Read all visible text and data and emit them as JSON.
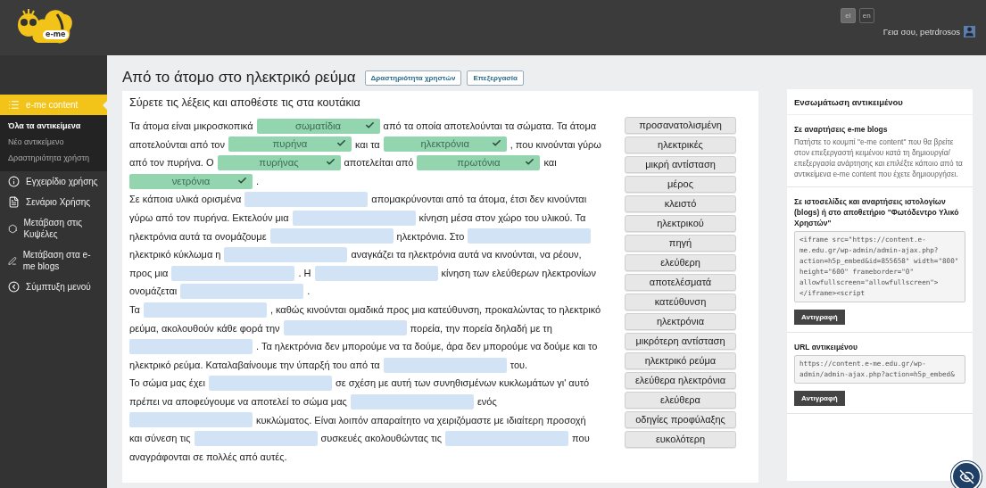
{
  "header": {
    "logo_text": "e-me",
    "languages": [
      {
        "label": "el",
        "selected": true
      },
      {
        "label": "en",
        "selected": false
      }
    ],
    "greeting": "Γεια σου, petrdrosos"
  },
  "sidebar": {
    "items": [
      {
        "label": "e-me content",
        "selected": true,
        "expanded": true,
        "children": [
          {
            "label": "Όλα τα αντικείμενα",
            "selected": true
          },
          {
            "label": "Νέο αντικείμενο",
            "selected": false
          },
          {
            "label": "Δραστηριότητα χρήστη",
            "selected": false
          }
        ]
      },
      {
        "label": "Εγχειρίδιο χρήσης",
        "selected": false
      },
      {
        "label": "Σενάριο Χρήσης",
        "selected": false
      },
      {
        "label": "Μετάβαση στις Κυψέλες",
        "selected": false
      },
      {
        "label": "Μετάβαση στα e-me blogs",
        "selected": false
      },
      {
        "label": "Σύμπτυξη μενού",
        "selected": false
      }
    ]
  },
  "page": {
    "title": "Από το άτομο στο ηλεκτρικό ρεύμα",
    "buttons": [
      "Δραστηριότητα χρηστών",
      "Επεξεργασία"
    ],
    "instruction": "Σύρετε τις λέξεις και αποθέστε τις στα κουτάκια",
    "paragraphs": [
      [
        {
          "kind": "text",
          "text": "Τα άτομα είναι μικροσκοπικά"
        },
        {
          "kind": "answer",
          "text": "σωματίδια",
          "correct": true
        },
        {
          "kind": "text",
          "text": "από τα οποία αποτελούνται τα σώματα. Τα άτομα"
        }
      ],
      [
        {
          "kind": "text",
          "text": "αποτελούνται από τον"
        },
        {
          "kind": "answer",
          "text": "πυρήνα",
          "correct": true
        },
        {
          "kind": "text",
          "text": "και τα"
        },
        {
          "kind": "answer",
          "text": "ηλεκτρόνια",
          "correct": true
        },
        {
          "kind": "text",
          "text": ", που κινούνται γύρω"
        }
      ],
      [
        {
          "kind": "text",
          "text": "από τον πυρήνα. Ο"
        },
        {
          "kind": "answer",
          "text": "πυρήνας",
          "correct": true
        },
        {
          "kind": "text",
          "text": "αποτελείται από"
        },
        {
          "kind": "answer",
          "text": "πρωτόνια",
          "correct": true
        },
        {
          "kind": "text",
          "text": "και"
        }
      ],
      [
        {
          "kind": "answer",
          "text": "νετρόνια",
          "correct": true
        },
        {
          "kind": "text",
          "text": "."
        }
      ],
      [
        {
          "kind": "text",
          "text": "Σε κάποια υλικά ορισμένα"
        },
        {
          "kind": "blank"
        },
        {
          "kind": "text",
          "text": "απομακρύνονται από τα άτομα, έτσι δεν κινούνται"
        }
      ],
      [
        {
          "kind": "text",
          "text": "γύρω από τον πυρήνα. Εκτελούν μια"
        },
        {
          "kind": "blank"
        },
        {
          "kind": "text",
          "text": "κίνηση μέσα στον χώρο του υλικού. Τα"
        }
      ],
      [
        {
          "kind": "text",
          "text": "ηλεκτρόνια αυτά τα ονομάζουμε"
        },
        {
          "kind": "blank"
        },
        {
          "kind": "text",
          "text": "ηλεκτρόνια. Στο"
        },
        {
          "kind": "blank"
        }
      ],
      [
        {
          "kind": "text",
          "text": "ηλεκτρικό κύκλωμα η"
        },
        {
          "kind": "blank"
        },
        {
          "kind": "text",
          "text": "αναγκάζει τα ηλεκτρόνια αυτά να κινούνται, να ρέουν,"
        }
      ],
      [
        {
          "kind": "text",
          "text": "προς μια"
        },
        {
          "kind": "blank"
        },
        {
          "kind": "text",
          "text": ". Η"
        },
        {
          "kind": "blank"
        },
        {
          "kind": "text",
          "text": "κίνηση των ελεύθερων ηλεκτρονίων"
        }
      ],
      [
        {
          "kind": "text",
          "text": "ονομάζεται"
        },
        {
          "kind": "blank"
        },
        {
          "kind": "text",
          "text": "."
        }
      ],
      [
        {
          "kind": "text",
          "text": "Τα"
        },
        {
          "kind": "blank"
        },
        {
          "kind": "text",
          "text": ", καθώς κινούνται ομαδικά προς μια κατεύθυνση, προκαλώντας το ηλεκτρικό"
        }
      ],
      [
        {
          "kind": "text",
          "text": "ρεύμα, ακολουθούν κάθε φορά την"
        },
        {
          "kind": "blank"
        },
        {
          "kind": "text",
          "text": "πορεία, την πορεία δηλαδή με τη"
        }
      ],
      [
        {
          "kind": "blank"
        },
        {
          "kind": "text",
          "text": ". Τα ηλεκτρόνια δεν μπορούμε να τα δούμε, άρα δεν μπορούμε να δούμε και το"
        }
      ],
      [
        {
          "kind": "text",
          "text": "ηλεκτρικό ρεύμα. Καταλαβαίνουμε την ύπαρξή του από τα"
        },
        {
          "kind": "blank"
        },
        {
          "kind": "text",
          "text": "του."
        }
      ],
      [
        {
          "kind": "text",
          "text": "Το σώμα μας έχει"
        },
        {
          "kind": "blank"
        },
        {
          "kind": "text",
          "text": "σε σχέση με αυτή των συνηθισμένων κυκλωμάτων γι' αυτό"
        }
      ],
      [
        {
          "kind": "text",
          "text": "πρέπει να αποφεύγουμε να αποτελεί το σώμα μας"
        },
        {
          "kind": "blank"
        },
        {
          "kind": "text",
          "text": "ενός"
        }
      ],
      [
        {
          "kind": "blank"
        },
        {
          "kind": "text",
          "text": "κυκλώματος. Είναι λοιπόν απαραίτητο να χειριζόμαστε με ιδιαίτερη προσοχή"
        }
      ],
      [
        {
          "kind": "text",
          "text": "και σύνεση τις"
        },
        {
          "kind": "blank"
        },
        {
          "kind": "text",
          "text": "συσκευές ακολουθώντας τις"
        },
        {
          "kind": "blank"
        },
        {
          "kind": "text",
          "text": "που"
        }
      ],
      [
        {
          "kind": "text",
          "text": "αναγράφονται σε πολλές από αυτές."
        }
      ]
    ],
    "word_bank": [
      "προσανατολισμένη",
      "ηλεκτρικές",
      "μικρή αντίσταση",
      "μέρος",
      "κλειστό",
      "ηλεκτρικού",
      "πηγή",
      "ελεύθερη",
      "αποτελέσματά",
      "κατεύθυνση",
      "ηλεκτρόνια",
      "μικρότερη αντίσταση",
      "ηλεκτρικό ρεύμα",
      "ελεύθερα ηλεκτρόνια",
      "ελεύθερα",
      "οδηγίες προφύλαξης",
      "ευκολότερη"
    ]
  },
  "embed_panel": {
    "title": "Ενσωμάτωση αντικειμένου",
    "sections": [
      {
        "kind": "info",
        "heading": "Σε αναρτήσεις e-me blogs",
        "text": "Πατήστε το κουμπί \"e-me content\" που θα βρείτε στον επεξεργαστή κειμένου κατά τη δημιουργία/επεξεργασία ανάρτησης και επιλέξτε κάποιο από τα αντικείμενα e-me content που έχετε δημιουργήσει."
      },
      {
        "kind": "code",
        "heading": "Σε ιστοσελίδες και αναρτήσεις ιστολογίων (blogs) ή στο αποθετήριο \"Φωτόδεντρο Υλικό Χρηστών\"",
        "code": "<iframe src=\"https://content.e-me.edu.gr/wp-admin/admin-ajax.php?action=h5p_embed&id=855658\" width=\"800\" height=\"600\" frameborder=\"0\" allowfullscreen=\"allowfullscreen\"></iframe><script",
        "button": "Αντιγραφή"
      },
      {
        "kind": "code",
        "heading": "URL αντικειμένου",
        "code": "https://content.e-me.edu.gr/wp-admin/admin-ajax.php?action=h5p_embed&",
        "button": "Αντιγραφή"
      }
    ]
  }
}
